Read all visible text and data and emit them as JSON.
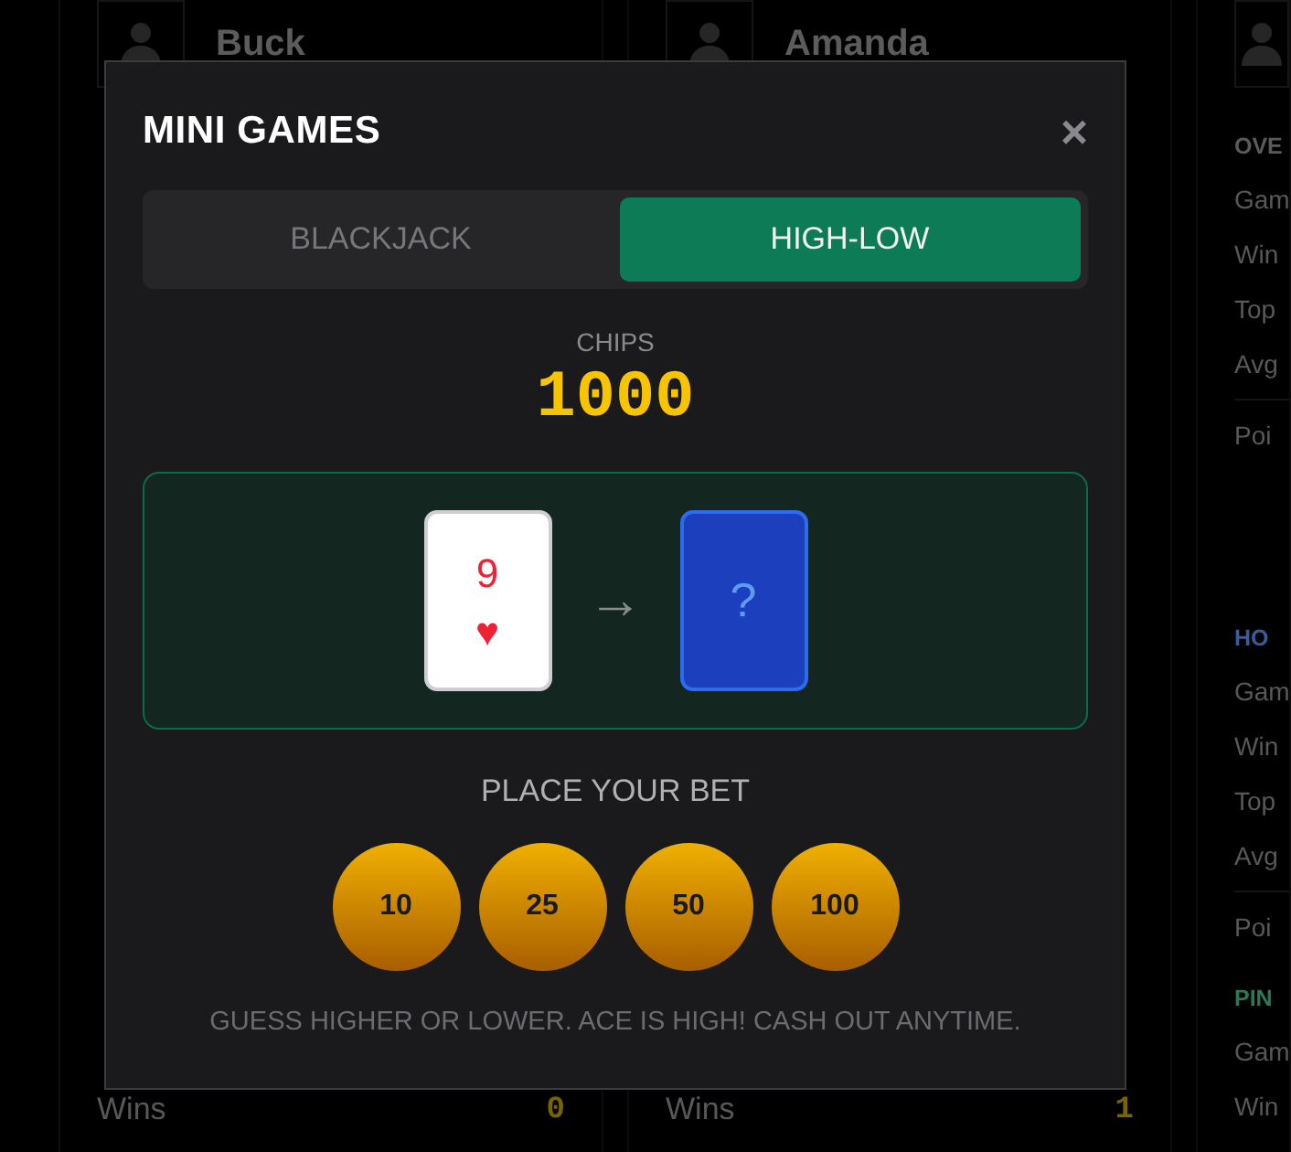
{
  "players": [
    {
      "name": "Buck",
      "rows": [
        {
          "label": "Wins",
          "value": "0"
        }
      ]
    },
    {
      "name": "Amanda",
      "rows": [
        {
          "label": "Wins",
          "value": "1"
        }
      ]
    },
    {
      "sections": [
        {
          "title": "OVE",
          "color": "#5a5a5a",
          "rows": [
            "Gam",
            "Win",
            "Top",
            "Avg"
          ],
          "total": "Poi"
        },
        {
          "title": "HO",
          "color": "#3a5c9a",
          "rows": [
            "Gam",
            "Win",
            "Top",
            "Avg"
          ],
          "total": "Poi"
        },
        {
          "title": "PIN",
          "color": "#2a7a56",
          "rows": [
            "Gam",
            "Win"
          ]
        }
      ]
    }
  ],
  "modal": {
    "title": "MINI GAMES",
    "close": "×",
    "tabs": [
      {
        "label": "BLACKJACK",
        "selected": false
      },
      {
        "label": "HIGH-LOW",
        "selected": true
      }
    ],
    "chips_label": "CHIPS",
    "chips": "1000",
    "cards": [
      {
        "kind": "face",
        "rank": "9",
        "suit": "♥"
      },
      {
        "kind": "arrow",
        "text": "→"
      },
      {
        "kind": "back",
        "text": "?"
      }
    ],
    "bet_label": "PLACE YOUR BET",
    "bets": [
      "10",
      "25",
      "50",
      "100"
    ],
    "hint": "GUESS HIGHER OR LOWER. ACE IS HIGH! CASH OUT ANYTIME."
  }
}
